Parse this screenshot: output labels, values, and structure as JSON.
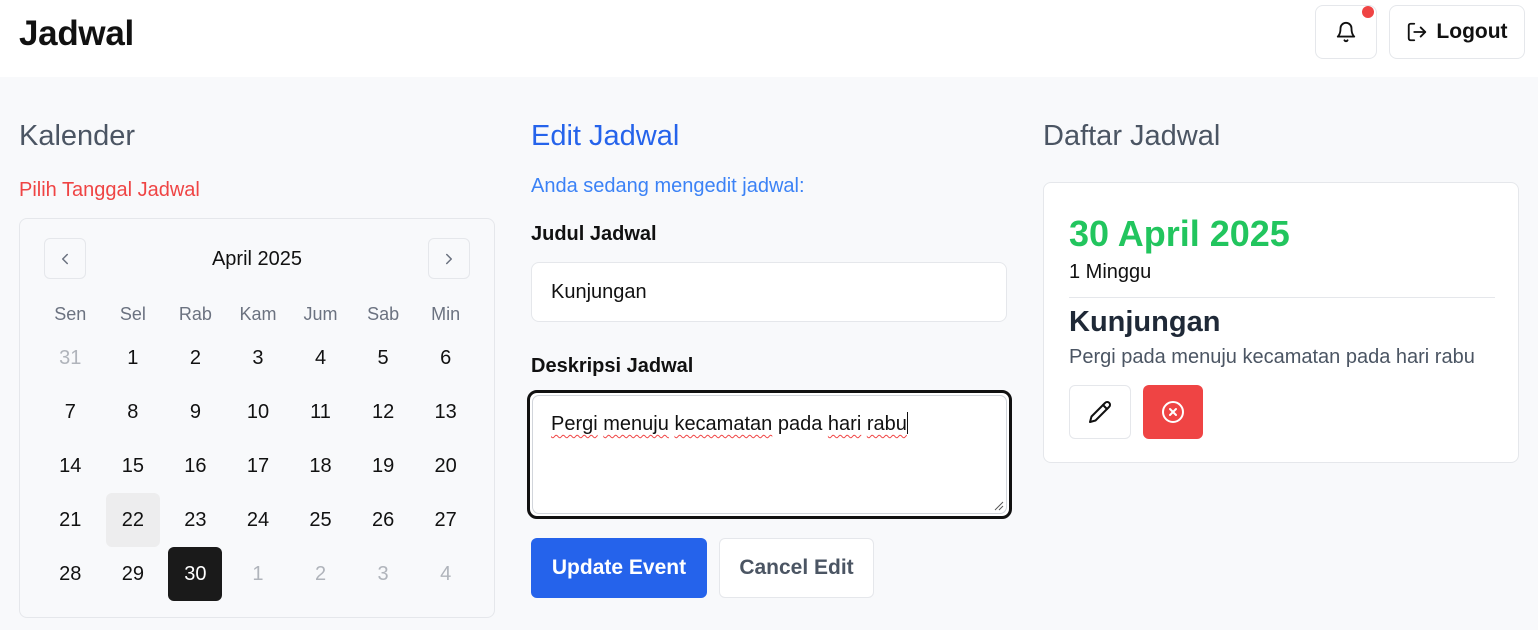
{
  "header": {
    "title": "Jadwal",
    "logout_label": "Logout",
    "notification_icon": "bell-icon",
    "notification_badge_color": "#ef4444"
  },
  "calendar": {
    "title": "Kalender",
    "subtitle": "Pilih Tanggal Jadwal",
    "month_label": "April 2025",
    "weekdays": [
      "Sen",
      "Sel",
      "Rab",
      "Kam",
      "Jum",
      "Sab",
      "Min"
    ],
    "days": [
      {
        "label": "31",
        "state": "outside"
      },
      {
        "label": "1",
        "state": ""
      },
      {
        "label": "2",
        "state": ""
      },
      {
        "label": "3",
        "state": ""
      },
      {
        "label": "4",
        "state": ""
      },
      {
        "label": "5",
        "state": ""
      },
      {
        "label": "6",
        "state": ""
      },
      {
        "label": "7",
        "state": ""
      },
      {
        "label": "8",
        "state": ""
      },
      {
        "label": "9",
        "state": ""
      },
      {
        "label": "10",
        "state": ""
      },
      {
        "label": "11",
        "state": ""
      },
      {
        "label": "12",
        "state": ""
      },
      {
        "label": "13",
        "state": ""
      },
      {
        "label": "14",
        "state": ""
      },
      {
        "label": "15",
        "state": ""
      },
      {
        "label": "16",
        "state": ""
      },
      {
        "label": "17",
        "state": ""
      },
      {
        "label": "18",
        "state": ""
      },
      {
        "label": "19",
        "state": ""
      },
      {
        "label": "20",
        "state": ""
      },
      {
        "label": "21",
        "state": ""
      },
      {
        "label": "22",
        "state": "today"
      },
      {
        "label": "23",
        "state": ""
      },
      {
        "label": "24",
        "state": ""
      },
      {
        "label": "25",
        "state": ""
      },
      {
        "label": "26",
        "state": ""
      },
      {
        "label": "27",
        "state": ""
      },
      {
        "label": "28",
        "state": ""
      },
      {
        "label": "29",
        "state": ""
      },
      {
        "label": "30",
        "state": "selected"
      },
      {
        "label": "1",
        "state": "outside"
      },
      {
        "label": "2",
        "state": "outside"
      },
      {
        "label": "3",
        "state": "outside"
      },
      {
        "label": "4",
        "state": "outside"
      }
    ]
  },
  "edit": {
    "title": "Edit Jadwal",
    "subtitle": "Anda sedang mengedit jadwal:",
    "title_label": "Judul Jadwal",
    "title_value": "Kunjungan",
    "desc_label": "Deskripsi Jadwal",
    "desc_words": [
      "Pergi",
      "menuju",
      "kecamatan",
      "pada",
      "hari",
      "rabu"
    ],
    "update_label": "Update Event",
    "cancel_label": "Cancel Edit",
    "accent_color": "#2563eb"
  },
  "list": {
    "title": "Daftar Jadwal",
    "events": [
      {
        "date": "30 April 2025",
        "duration": "1 Minggu",
        "title": "Kunjungan",
        "description": "Pergi pada menuju kecamatan pada hari rabu",
        "date_color": "#22c55e",
        "delete_color": "#ef4444"
      }
    ]
  }
}
